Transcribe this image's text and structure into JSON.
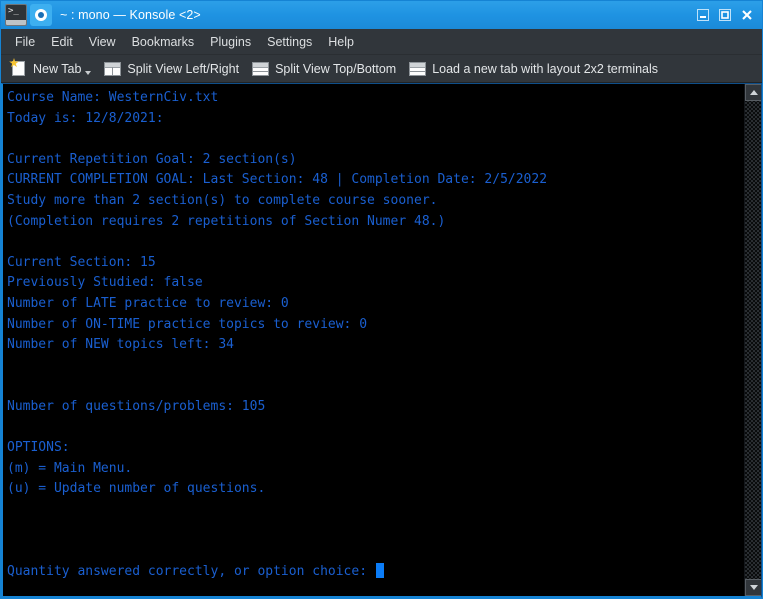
{
  "window": {
    "title": "~ : mono — Konsole <2>",
    "app_icon": "terminal-icon",
    "tab_icon": "konsole-icon",
    "titlebar_color": "#1f93e2",
    "buttons": {
      "minimize": "Minimize",
      "maximize": "Maximize",
      "close": "Close"
    }
  },
  "menubar": {
    "items": [
      {
        "label": "File"
      },
      {
        "label": "Edit"
      },
      {
        "label": "View"
      },
      {
        "label": "Bookmarks"
      },
      {
        "label": "Plugins"
      },
      {
        "label": "Settings"
      },
      {
        "label": "Help"
      }
    ]
  },
  "toolbar": {
    "items": [
      {
        "label": "New Tab",
        "icon": "new-tab-icon",
        "has_dropdown": true
      },
      {
        "label": "Split View Left/Right",
        "icon": "split-left-right-icon",
        "has_dropdown": false
      },
      {
        "label": "Split View Top/Bottom",
        "icon": "split-top-bottom-icon",
        "has_dropdown": false
      },
      {
        "label": "Load a new tab with layout 2x2 terminals",
        "icon": "layout-2x2-icon",
        "has_dropdown": false
      }
    ]
  },
  "terminal": {
    "foreground_color": "#1a5fd0",
    "background_color": "#000000",
    "cursor_color": "#0b7cf7",
    "lines": [
      "Course Name: WesternCiv.txt",
      "Today is: 12/8/2021:",
      "",
      "Current Repetition Goal: 2 section(s)",
      "CURRENT COMPLETION GOAL: Last Section: 48 | Completion Date: 2/5/2022",
      "Study more than 2 section(s) to complete course sooner.",
      "(Completion requires 2 repetitions of Section Numer 48.)",
      "",
      "Current Section: 15",
      "Previously Studied: false",
      "Number of LATE practice to review: 0",
      "Number of ON-TIME practice topics to review: 0",
      "Number of NEW topics left: 34",
      "",
      "",
      "Number of questions/problems: 105",
      "",
      "OPTIONS:",
      "(m) = Main Menu.",
      "(u) = Update number of questions.",
      "",
      "",
      "",
      "Quantity answered correctly, or option choice: "
    ],
    "prompt_line_index": 23
  },
  "scrollbar": {
    "up_arrow": "scroll-up-icon",
    "down_arrow": "scroll-down-icon"
  }
}
